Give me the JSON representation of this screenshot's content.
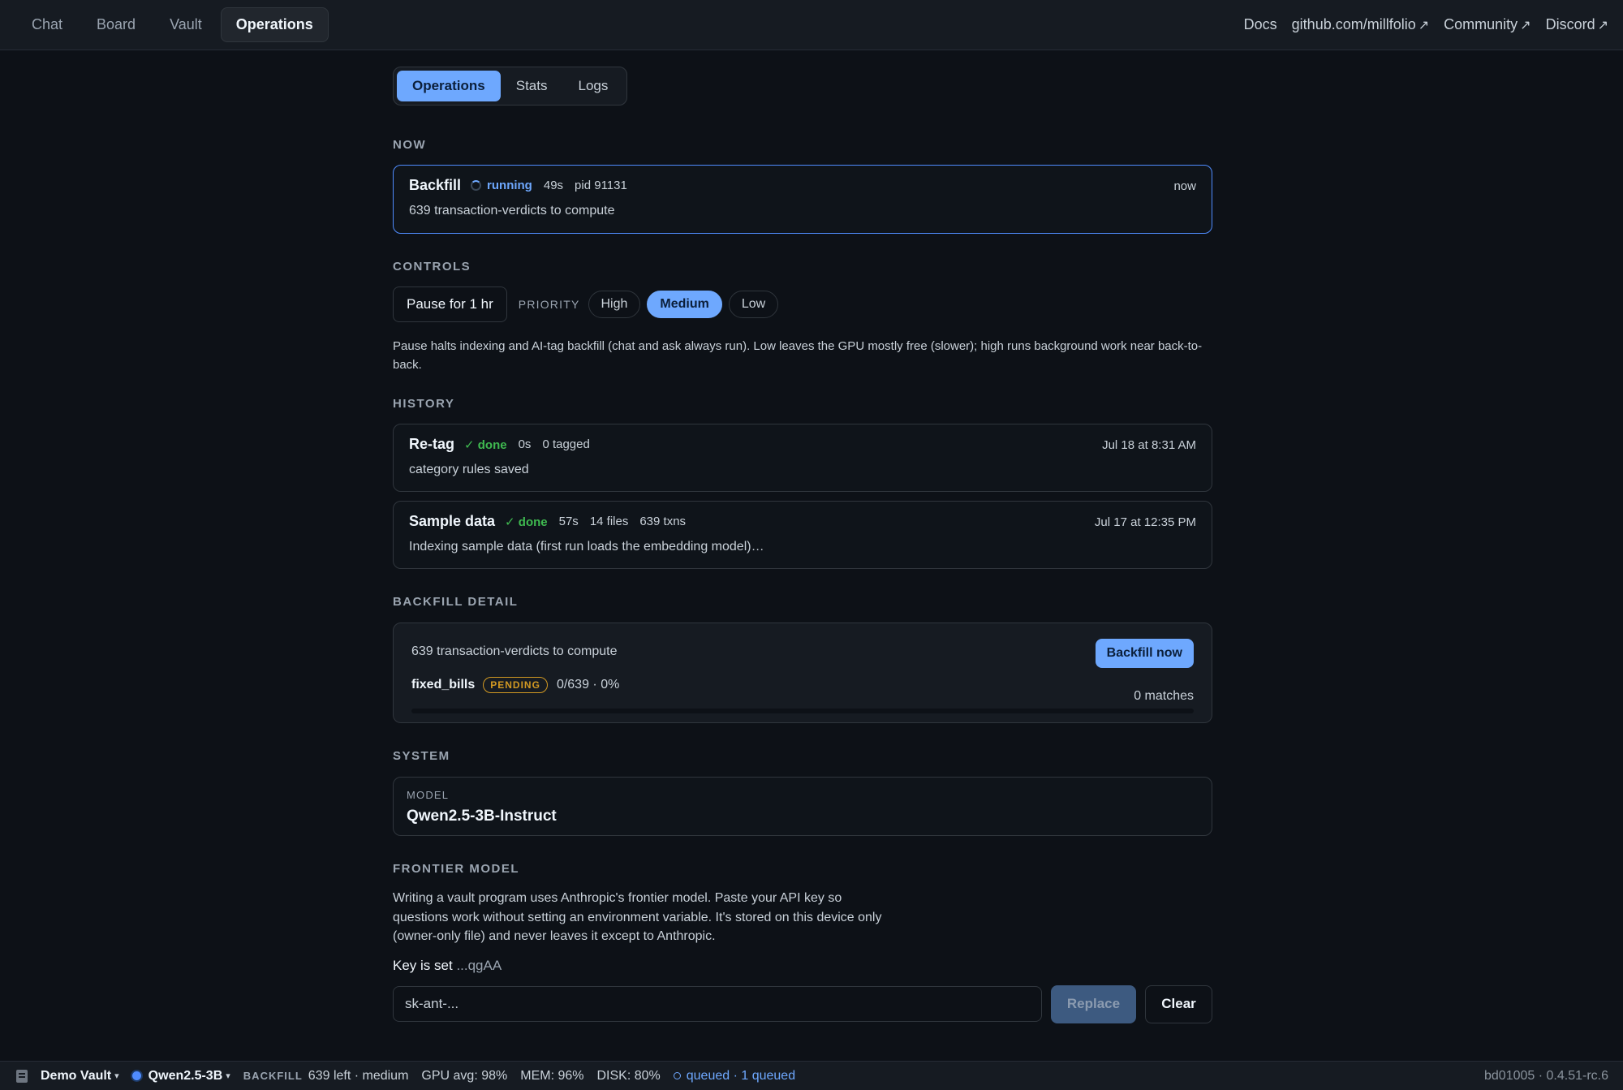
{
  "nav": {
    "tabs": [
      "Chat",
      "Board",
      "Vault",
      "Operations"
    ],
    "active_tab": "Operations",
    "links": [
      {
        "label": "Docs",
        "external": false
      },
      {
        "label": "github.com/millfolio",
        "external": true
      },
      {
        "label": "Community",
        "external": true
      },
      {
        "label": "Discord",
        "external": true
      }
    ],
    "external_arrow": "↗"
  },
  "subtabs": {
    "items": [
      "Operations",
      "Stats",
      "Logs"
    ],
    "active": "Operations"
  },
  "now": {
    "label": "NOW",
    "job": {
      "title": "Backfill",
      "status": "running",
      "duration": "49s",
      "pid": "pid 91131",
      "timestamp": "now",
      "description": "639 transaction-verdicts to compute"
    }
  },
  "controls": {
    "label": "CONTROLS",
    "pause_label": "Pause for 1 hr",
    "priority_label": "PRIORITY",
    "priorities": [
      "High",
      "Medium",
      "Low"
    ],
    "active_priority": "Medium",
    "help_text": "Pause halts indexing and AI-tag backfill (chat and ask always run). Low leaves the GPU mostly free (slower); high runs background work near back-to-back."
  },
  "history": {
    "label": "HISTORY",
    "items": [
      {
        "title": "Re-tag",
        "status": "✓ done",
        "meta": [
          "0s",
          "0 tagged"
        ],
        "timestamp": "Jul 18 at 8:31 AM",
        "description": "category rules saved"
      },
      {
        "title": "Sample data",
        "status": "✓ done",
        "meta": [
          "57s",
          "14 files",
          "639 txns"
        ],
        "timestamp": "Jul 17 at 12:35 PM",
        "description": "Indexing sample data (first run loads the embedding model)…"
      }
    ]
  },
  "backfill_detail": {
    "label": "BACKFILL DETAIL",
    "summary": "639 transaction-verdicts to compute",
    "button_label": "Backfill now",
    "task": {
      "name": "fixed_bills",
      "badge": "PENDING",
      "count": "0/639 · 0%",
      "matches": "0 matches",
      "progress_fraction": 0
    }
  },
  "system": {
    "label": "SYSTEM",
    "model_label": "MODEL",
    "model_value": "Qwen2.5-3B-Instruct"
  },
  "frontier": {
    "label": "FRONTIER MODEL",
    "text": "Writing a vault program uses Anthropic's frontier model. Paste your API key so questions work without setting an environment variable. It's stored on this device only (owner-only file) and never leaves it except to Anthropic.",
    "key_status": "Key is set",
    "key_mask": "...qgAA",
    "input_placeholder": "sk-ant-...",
    "replace_label": "Replace",
    "clear_label": "Clear"
  },
  "statusbar": {
    "vault": "Demo Vault",
    "model": "Qwen2.5-3B",
    "caret": "▾",
    "backfill_label": "BACKFILL",
    "backfill_value": "639 left · medium",
    "gpu": "GPU avg: 98%",
    "mem": "MEM: 96%",
    "disk": "DISK: 80%",
    "queued": "queued · 1 queued",
    "version": "bd01005 · 0.4.51-rc.6"
  }
}
